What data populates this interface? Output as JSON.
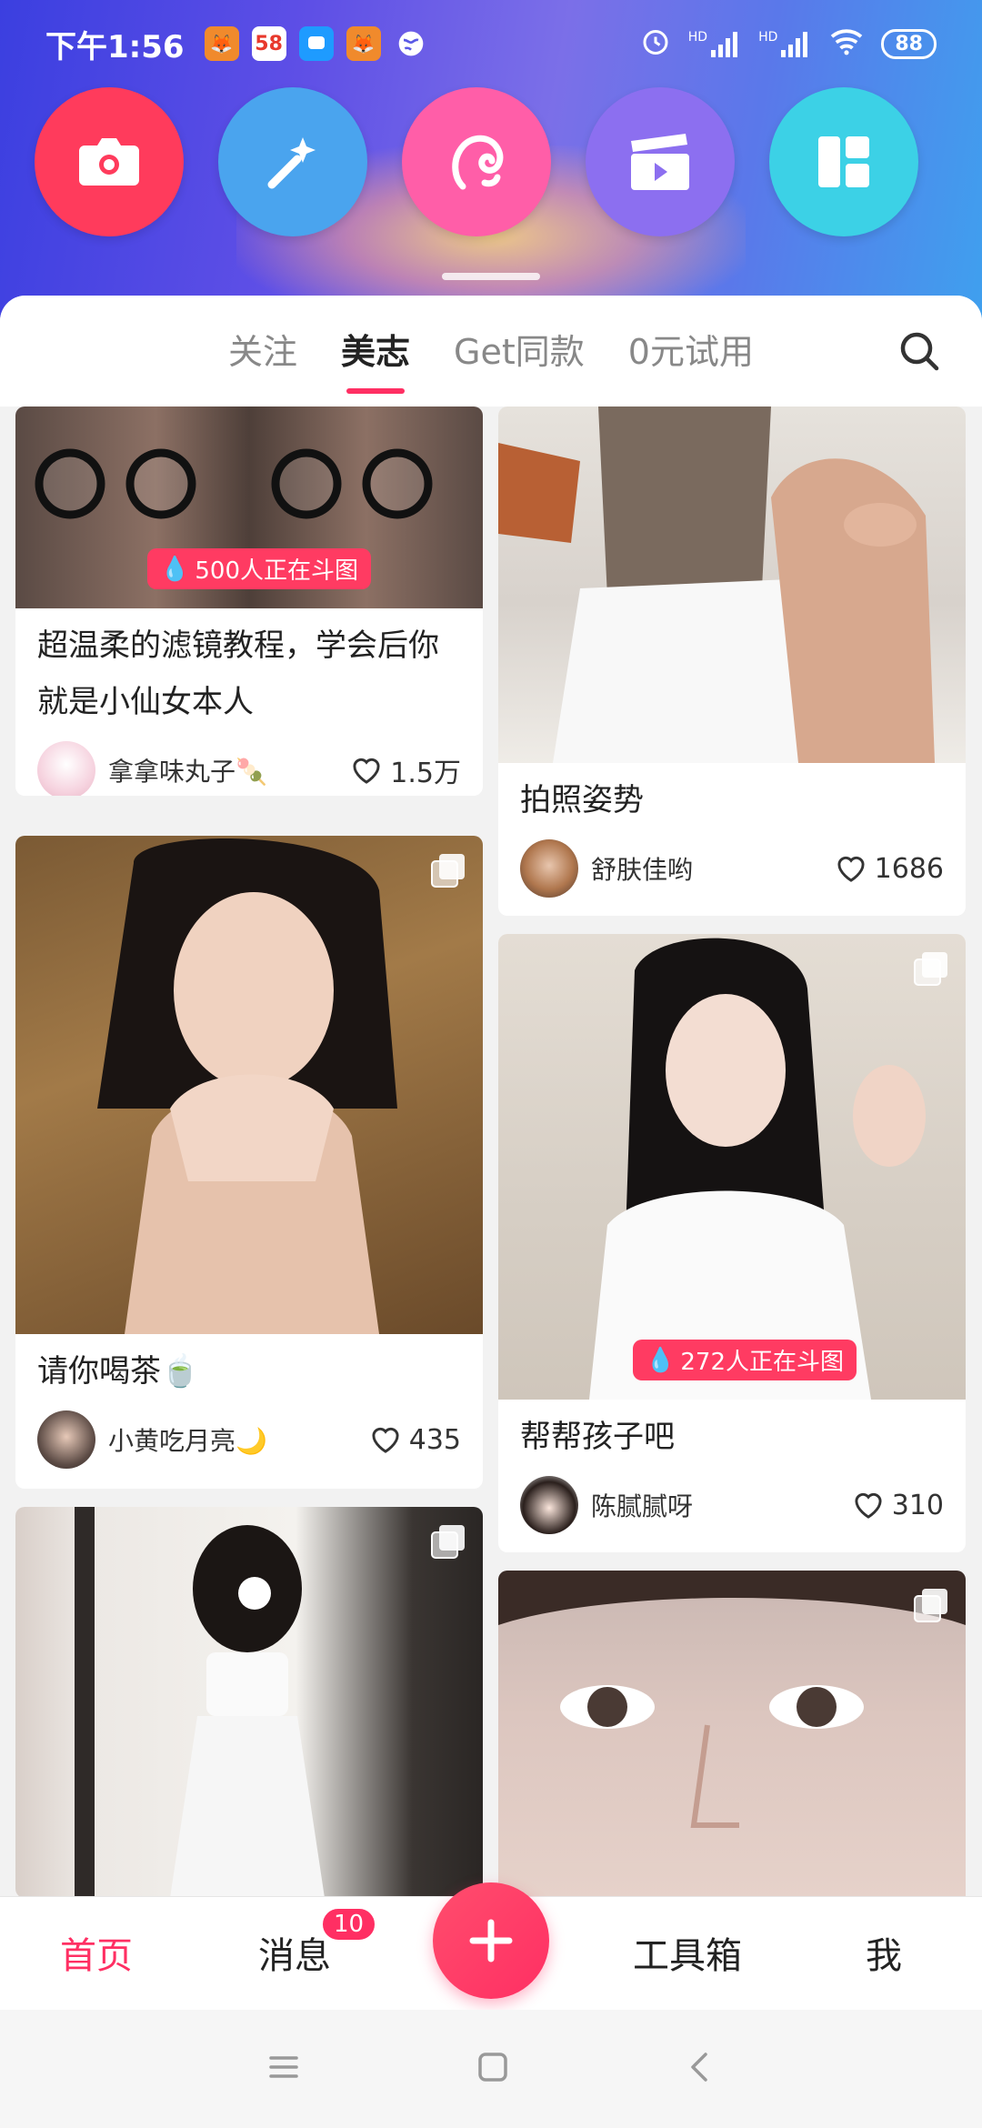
{
  "status_bar": {
    "time": "下午1:56",
    "app_icons": [
      {
        "name": "fox-app-icon",
        "label": "",
        "color": "#f08a2c"
      },
      {
        "name": "58-app-icon",
        "label": "58",
        "color": "#ffffff"
      },
      {
        "name": "chat-app-icon",
        "label": "",
        "color": "#1e9bff"
      },
      {
        "name": "fox-app-icon-2",
        "label": "",
        "color": "#f08a2c"
      },
      {
        "name": "globe-app-icon",
        "label": "",
        "color": "#ffffff"
      }
    ],
    "hd_label_1": "HD",
    "hd_label_2": "HD",
    "battery": "88"
  },
  "tools": [
    {
      "name": "camera-tool-button",
      "icon": "camera-icon",
      "color": "#ff3b5c"
    },
    {
      "name": "magic-wand-tool-button",
      "icon": "magic-wand-icon",
      "color": "#4aa4ee"
    },
    {
      "name": "beauty-tool-button",
      "icon": "hair-icon",
      "color": "#ff5ea8"
    },
    {
      "name": "video-tool-button",
      "icon": "clapperboard-icon",
      "color": "#8c6ff0"
    },
    {
      "name": "collage-tool-button",
      "icon": "collage-icon",
      "color": "#3cd1e6"
    }
  ],
  "tabs": [
    {
      "label": "关注",
      "active": false
    },
    {
      "label": "美志",
      "active": true
    },
    {
      "label": "Get同款",
      "active": false
    },
    {
      "label": "0元试用",
      "active": false
    }
  ],
  "feed": {
    "left": [
      {
        "title": "超温柔的滤镜教程，学会后你就是小仙女本人",
        "author": "拿拿味丸子🍡",
        "likes": "1.5万",
        "badge": "500人正在斗图"
      },
      {
        "title": "请你喝茶🍵",
        "author": "小黄吃月亮🌙",
        "likes": "435"
      }
    ],
    "right": [
      {
        "title": "拍照姿势",
        "author": "舒肤佳哟",
        "likes": "1686"
      },
      {
        "title": "帮帮孩子吧",
        "author": "陈腻腻呀",
        "likes": "310",
        "badge": "272人正在斗图"
      }
    ]
  },
  "bottom_nav": {
    "home": "首页",
    "messages": "消息",
    "messages_badge": "10",
    "toolbox": "工具箱",
    "me": "我"
  },
  "colors": {
    "accent": "#ff2f63"
  }
}
